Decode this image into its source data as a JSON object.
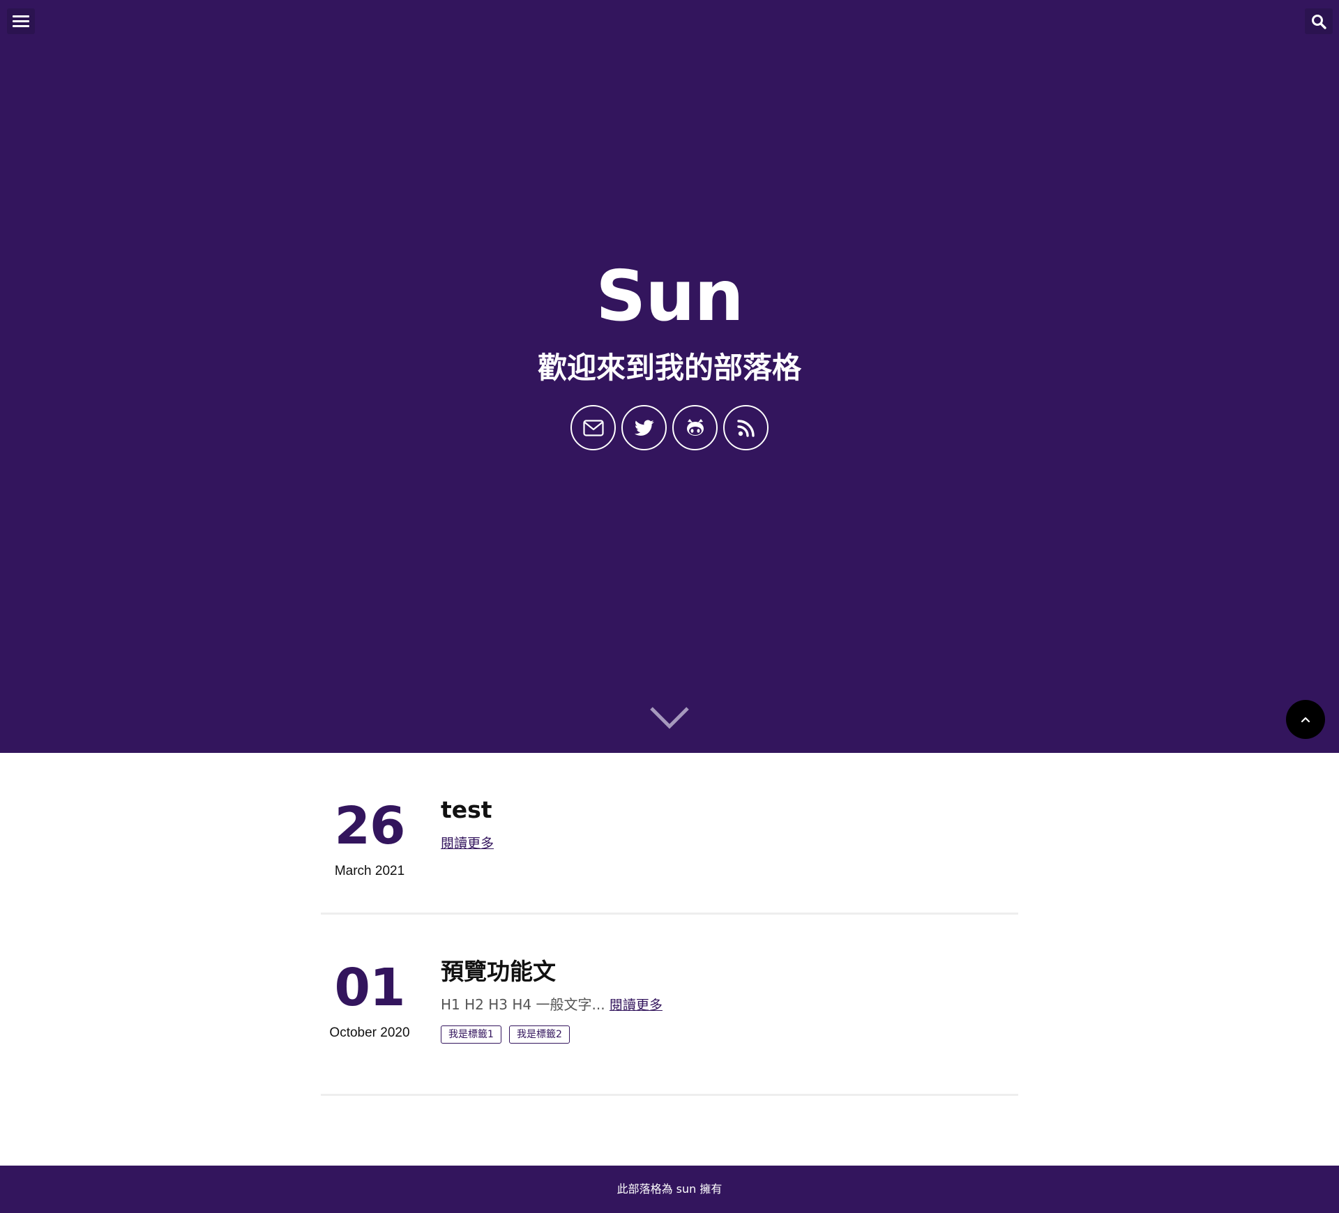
{
  "header": {
    "menu_icon": "hamburger-menu-icon",
    "search_icon": "search-icon"
  },
  "hero": {
    "title": "Sun",
    "subtitle": "歡迎來到我的部落格",
    "social": [
      {
        "icon": "envelope-icon"
      },
      {
        "icon": "twitter-icon"
      },
      {
        "icon": "github-icon"
      },
      {
        "icon": "rss-icon"
      }
    ],
    "scroll_icon": "chevron-down-icon",
    "back_to_top_icon": "chevron-up-icon"
  },
  "posts": [
    {
      "day": "26",
      "month_year": "March 2021",
      "title": "test",
      "excerpt": "",
      "read_more": "閱讀更多",
      "tags": []
    },
    {
      "day": "01",
      "month_year": "October 2020",
      "title": "預覽功能文",
      "excerpt": "H1 H2 H3 H4 一般文字...",
      "read_more": "閱讀更多",
      "tags": [
        "我是標籤1",
        "我是標籤2"
      ]
    }
  ],
  "footer": {
    "text": "此部落格為 sun 擁有"
  },
  "colors": {
    "brand": "#33155d",
    "header_button_bg": "#2b1350",
    "back_to_top_bg": "#000000",
    "divider": "#eeeeee"
  }
}
